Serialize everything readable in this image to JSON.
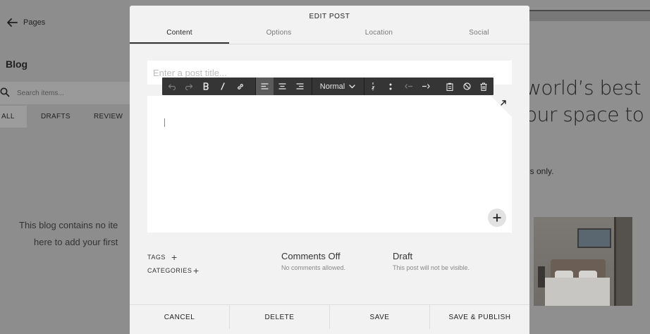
{
  "sidebar": {
    "back_label": "Pages",
    "section_title": "Blog",
    "search_placeholder": "Search items...",
    "filters": [
      "ALL",
      "DRAFTS",
      "REVIEW"
    ],
    "empty_line1": "This blog contains no ite",
    "empty_line2": "here to add your first"
  },
  "site_preview": {
    "headline_line1": "world’s best",
    "headline_line2": "our space to",
    "small_text": "es only."
  },
  "modal": {
    "title": "EDIT POST",
    "tabs": [
      "Content",
      "Options",
      "Location",
      "Social"
    ],
    "post_title_placeholder": "Enter a post title...",
    "toolbar": {
      "paragraph_style": "Normal"
    },
    "meta": {
      "tags_label": "TAGS",
      "categories_label": "CATEGORIES",
      "plus": "+",
      "comments_title": "Comments Off",
      "comments_sub": "No comments allowed.",
      "status_title": "Draft",
      "status_sub": "This post will not be visible."
    },
    "footer": {
      "cancel": "CANCEL",
      "delete": "DELETE",
      "save": "SAVE",
      "save_publish": "SAVE & PUBLISH"
    }
  }
}
